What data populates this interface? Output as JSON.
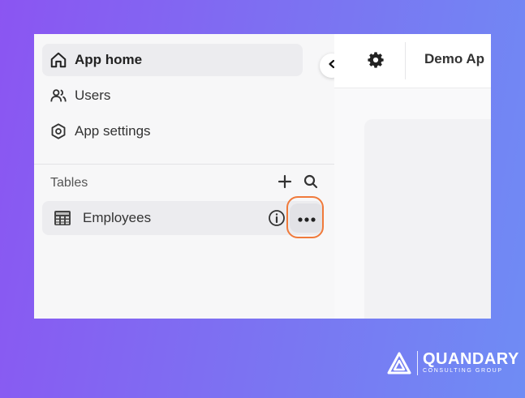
{
  "nav": {
    "items": [
      {
        "label": "App home",
        "icon": "home-icon",
        "active": true
      },
      {
        "label": "Users",
        "icon": "users-icon",
        "active": false
      },
      {
        "label": "App settings",
        "icon": "settings-icon",
        "active": false
      }
    ]
  },
  "tables": {
    "heading": "Tables",
    "add_icon": "plus-icon",
    "search_icon": "search-icon",
    "rows": [
      {
        "label": "Employees",
        "icon": "table-icon",
        "info_icon": "info-icon",
        "more_icon": "more-icon"
      }
    ]
  },
  "topbar": {
    "settings_icon": "gear-icon",
    "app_name": "Demo Ap"
  },
  "highlight_color": "#f07a3b",
  "brand": {
    "name": "QUANDARY",
    "tagline": "CONSULTING GROUP"
  }
}
